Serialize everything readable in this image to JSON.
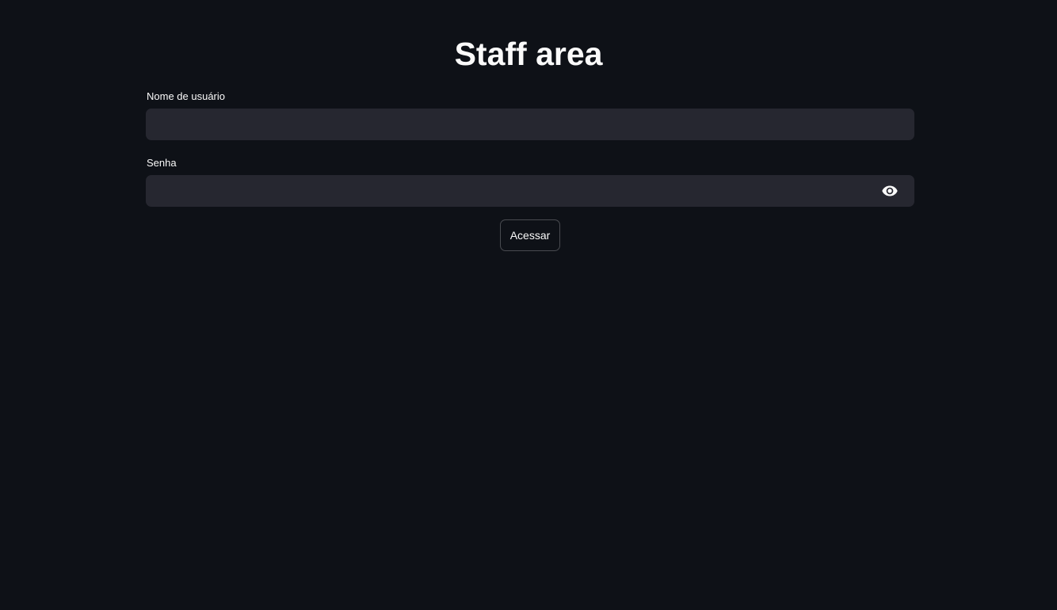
{
  "page": {
    "title": "Staff area"
  },
  "form": {
    "username": {
      "label": "Nome de usuário",
      "value": "",
      "placeholder": ""
    },
    "password": {
      "label": "Senha",
      "value": "",
      "placeholder": "",
      "toggle_icon": "eye-icon"
    },
    "submit_label": "Acessar"
  },
  "colors": {
    "background": "#0e1117",
    "input_background": "#262730",
    "text": "#fafafa"
  }
}
